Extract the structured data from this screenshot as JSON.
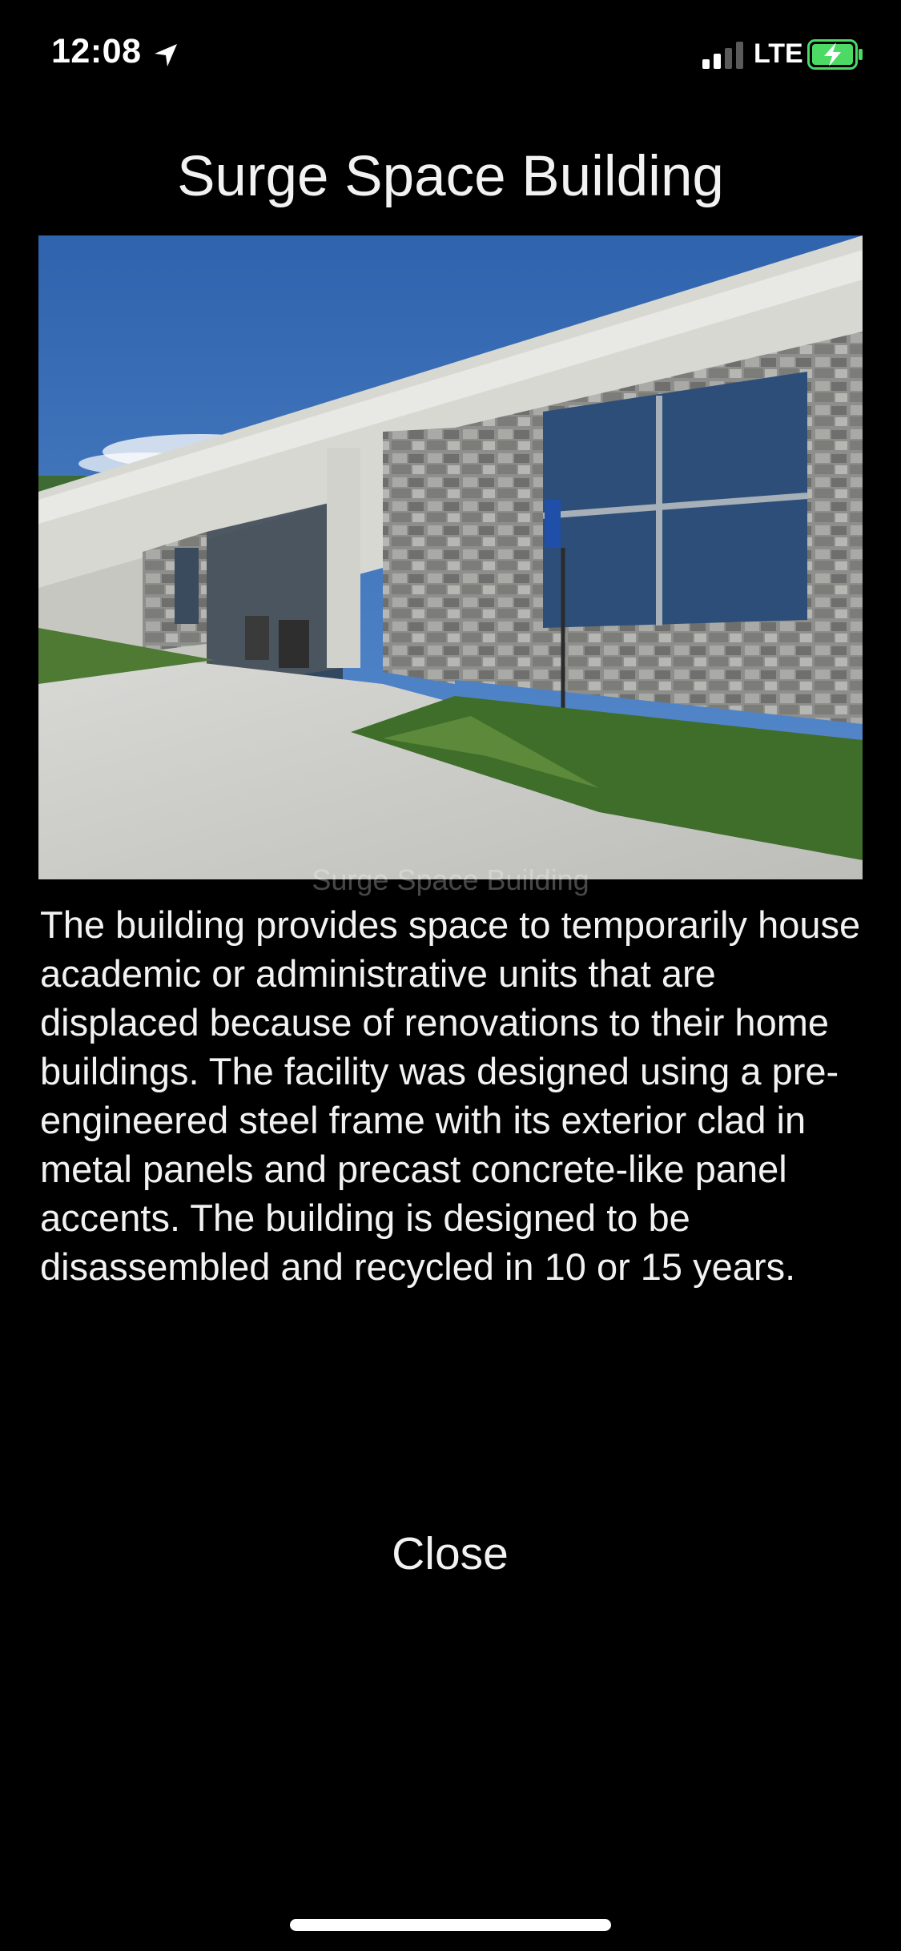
{
  "status_bar": {
    "time": "12:08",
    "network": "LTE",
    "battery_color": "#4cd964",
    "icons": [
      "location-arrow-icon",
      "signal-icon",
      "battery-charging-icon"
    ]
  },
  "title": "Surge Space Building",
  "image": {
    "caption": "Surge Space Building",
    "sky_color": "#3a6fb8"
  },
  "description": "The building provides space to temporarily house academic or administrative units that are displaced because of renovations to their home buildings. The facility was designed using a pre-engineered steel frame with its exterior clad in metal panels and precast concrete-like panel accents. The building is designed to be disassembled and recycled in 10 or 15 years.",
  "close_label": "Close"
}
